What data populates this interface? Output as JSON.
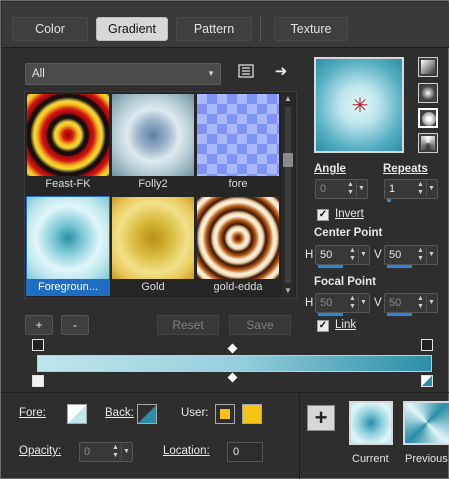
{
  "tabs": [
    {
      "label": "Color",
      "active": false
    },
    {
      "label": "Gradient",
      "active": true
    },
    {
      "label": "Pattern",
      "active": false
    },
    {
      "label": "Texture",
      "active": false
    }
  ],
  "library": {
    "category": "All",
    "items": [
      {
        "name": "Feast-FK",
        "selected": false
      },
      {
        "name": "Folly2",
        "selected": false
      },
      {
        "name": "fore",
        "selected": false
      },
      {
        "name": "Foregroun...",
        "selected": true
      },
      {
        "name": "Gold",
        "selected": false
      },
      {
        "name": "gold-edda",
        "selected": false
      }
    ],
    "add_label": "+",
    "remove_label": "-",
    "reset_label": "Reset",
    "save_label": "Save"
  },
  "properties": {
    "angle_label": "Angle",
    "angle_value": "0",
    "repeats_label": "Repeats",
    "repeats_value": "1",
    "invert_label": "Invert",
    "invert_checked": true,
    "center_point_label": "Center Point",
    "center_h_label": "H",
    "center_h_value": "50",
    "center_v_label": "V",
    "center_v_value": "50",
    "focal_point_label": "Focal Point",
    "focal_h_label": "H",
    "focal_h_value": "50",
    "focal_v_label": "V",
    "focal_v_value": "50",
    "link_label": "Link",
    "link_checked": true
  },
  "stops": {
    "fore_label": "Fore:",
    "back_label": "Back:",
    "user_label": "User:",
    "opacity_label": "Opacity:",
    "opacity_value": "0",
    "location_label": "Location:",
    "location_value": "0"
  },
  "presets": {
    "add_label": "+",
    "current_label": "Current",
    "previous_label": "Previous"
  },
  "colors": {
    "accent": "#2f86d6",
    "selected": "#1e6fc4",
    "gradient_light": "#bfe6ed",
    "gradient_dark": "#2b8ea8",
    "user_color": "#f3c416"
  }
}
